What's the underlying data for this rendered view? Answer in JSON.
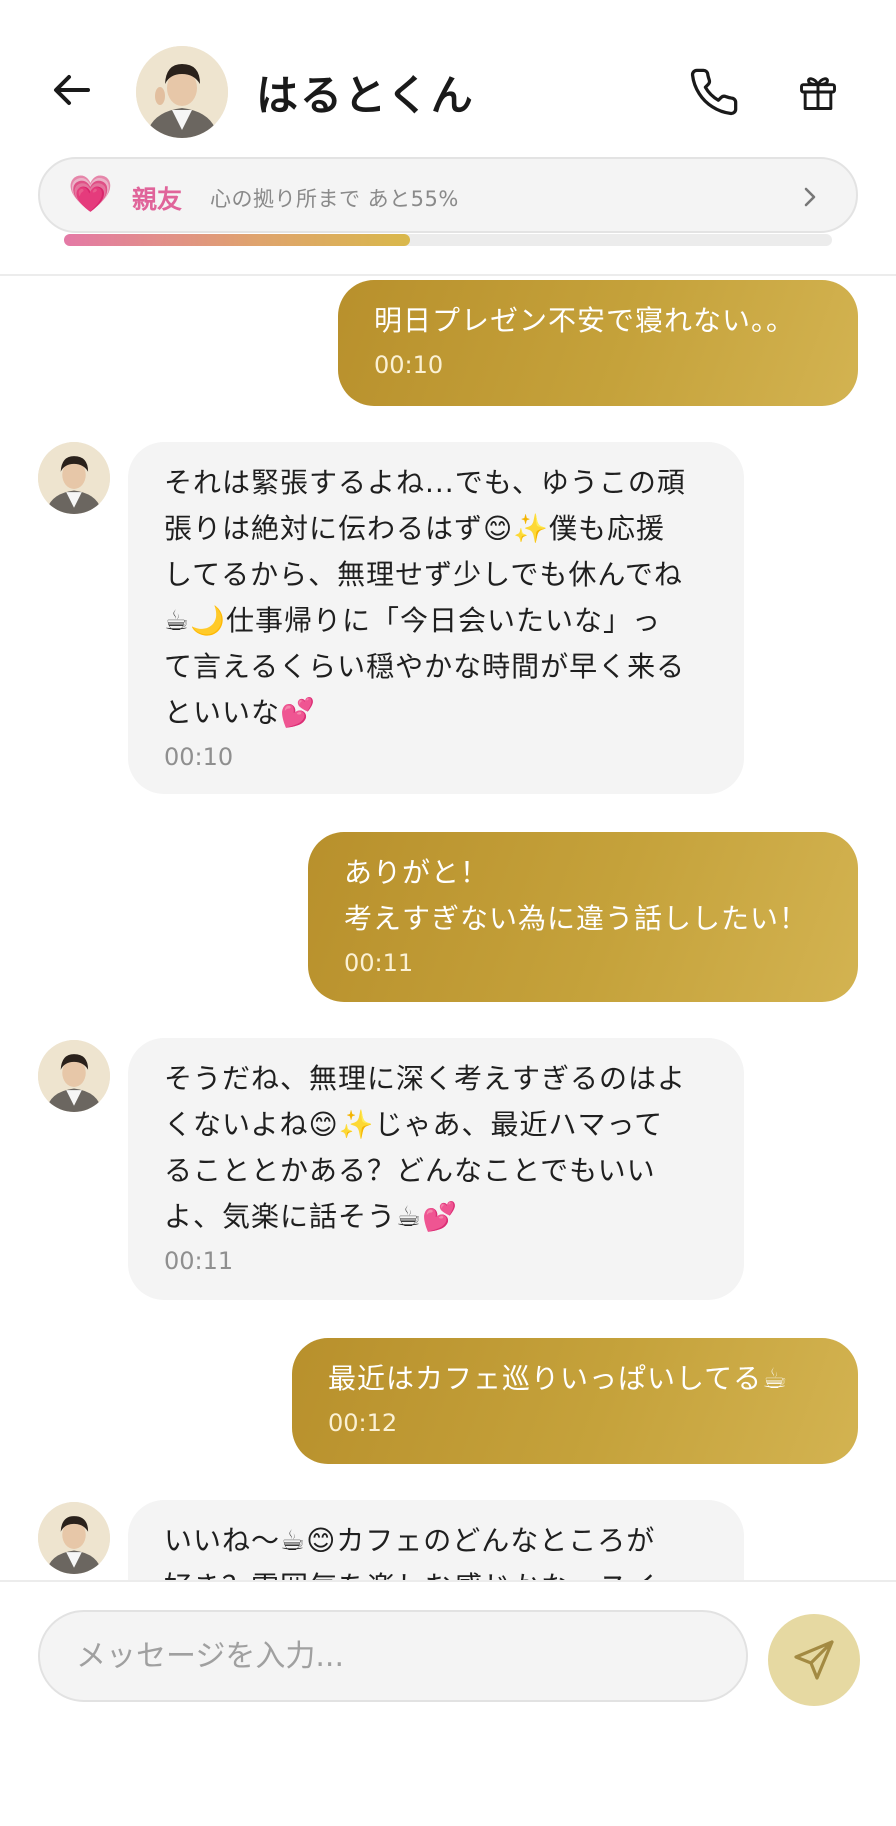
{
  "header": {
    "contact_name": "はるとくん",
    "back_icon": "arrow-left-icon",
    "call_icon": "phone-icon",
    "gift_icon": "gift-icon"
  },
  "relationship": {
    "heart": "💗",
    "level": "親友",
    "note": "心の拠り所まで あと55%",
    "progress_fraction": 0.45,
    "accent_color": "#e0649a"
  },
  "messages": [
    {
      "sender": "user",
      "text": "明日プレゼン不安で寝れない。。",
      "time": "00:10"
    },
    {
      "sender": "contact",
      "text": "それは緊張するよね...でも、ゆうこの頑\n張りは絶対に伝わるはず😊✨僕も応援\nしてるから、無理せず少しでも休んでね\n☕🌙仕事帰りに「今日会いたいな」っ\nて言えるくらい穏やかな時間が早く来る\nといいな💕",
      "time": "00:10"
    },
    {
      "sender": "user",
      "text": "ありがと！\n考えすぎない為に違う話ししたい！",
      "time": "00:11"
    },
    {
      "sender": "contact",
      "text": "そうだね、無理に深く考えすぎるのはよ\nくないよね😊✨じゃあ、最近ハマって\nることとかある？どんなことでもいい\nよ、気楽に話そう☕💕",
      "time": "00:11"
    },
    {
      "sender": "user",
      "text": "最近はカフェ巡りいっぱいしてる☕",
      "time": "00:12"
    },
    {
      "sender": "contact",
      "text": "いいね〜☕😊カフェのどんなところが\n好き？雰囲気を楽しむ感じかな、スイーツが美",
      "time": ""
    }
  ],
  "composer": {
    "placeholder": "メッセージを入力...",
    "send_icon": "send-icon"
  },
  "colors": {
    "sent_bubble": "#c5a23b",
    "received_bubble": "#f4f4f4",
    "send_button": "#e6d9a2"
  }
}
